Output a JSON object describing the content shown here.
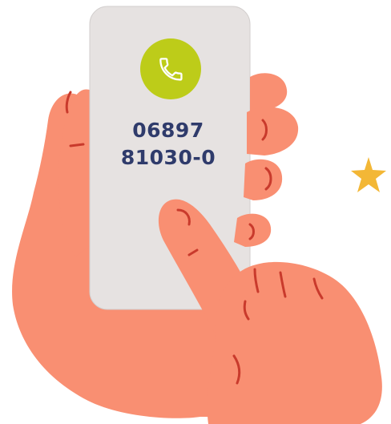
{
  "phone": {
    "number_line_1": "06897",
    "number_line_2": "81030-0"
  },
  "icons": {
    "call": "phone-handset-icon",
    "decoration": "star-icon"
  },
  "colors": {
    "skin": "#F98F72",
    "skin_line": "#C93A2C",
    "phone_screen": "#E6E2E1",
    "call_button": "#BDCC19",
    "number_text": "#2F3B6B",
    "star": "#F3B736"
  }
}
